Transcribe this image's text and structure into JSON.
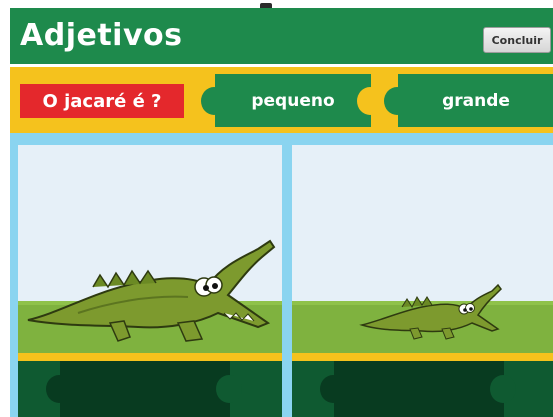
{
  "header": {
    "title": "Adjetivos",
    "button_label": "Concluir"
  },
  "question": {
    "text": "O jacaré é ?"
  },
  "options": [
    {
      "label": "pequeno"
    },
    {
      "label": "grande"
    }
  ],
  "colors": {
    "primary_green": "#1e8a4c",
    "yellow": "#f5c21d",
    "red": "#e4282c",
    "sky": "#8ad4f0",
    "dark_slot": "#083b20"
  },
  "cards": [
    {
      "image": "big-crocodile-image"
    },
    {
      "image": "small-crocodile-image"
    }
  ]
}
